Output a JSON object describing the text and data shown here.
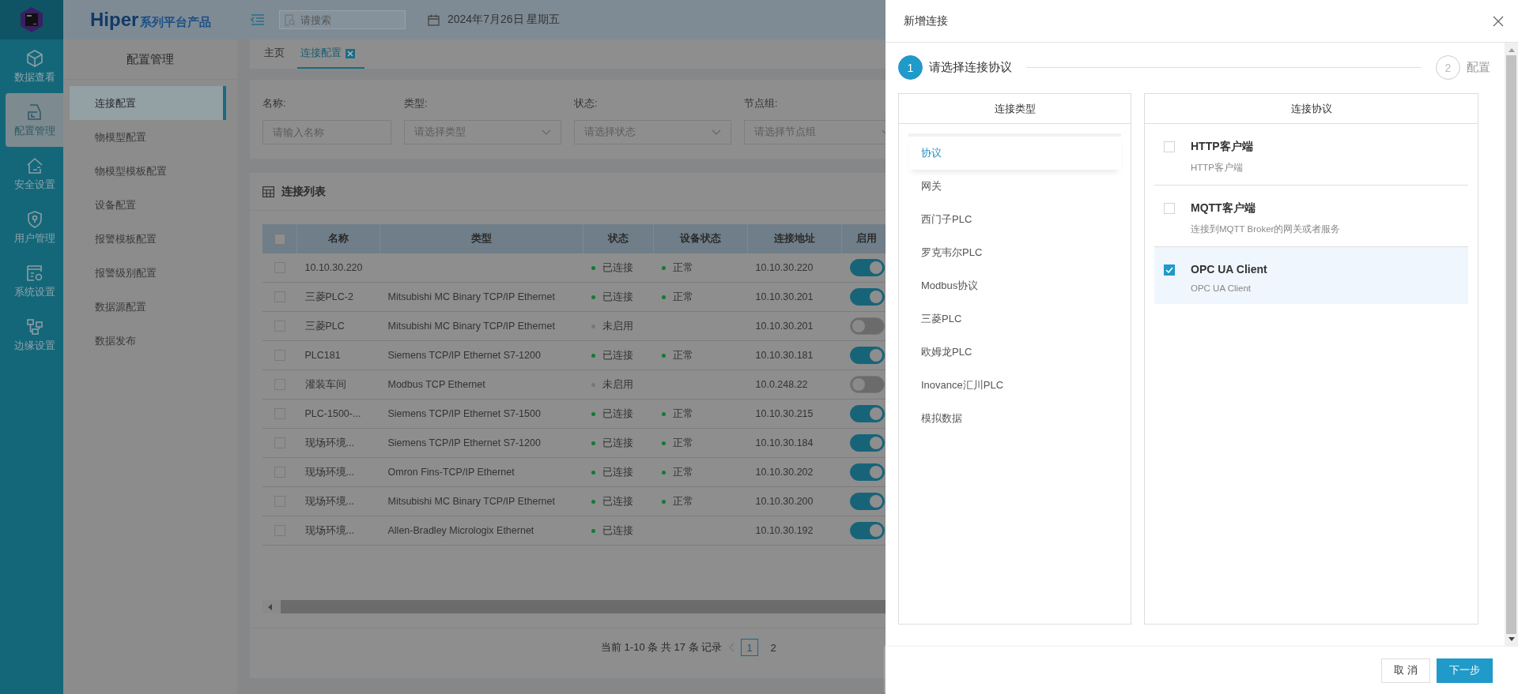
{
  "rail": {
    "items": [
      {
        "label": "数据查看",
        "selected": false
      },
      {
        "label": "配置管理",
        "selected": true
      },
      {
        "label": "安全设置",
        "selected": false
      },
      {
        "label": "用户管理",
        "selected": false
      },
      {
        "label": "系统设置",
        "selected": false
      },
      {
        "label": "边缘设置",
        "selected": false
      }
    ]
  },
  "sidebar": {
    "title": "配置管理",
    "items": [
      {
        "label": "连接配置",
        "selected": true
      },
      {
        "label": "物模型配置",
        "selected": false
      },
      {
        "label": "物模型模板配置",
        "selected": false
      },
      {
        "label": "设备配置",
        "selected": false
      },
      {
        "label": "报警模板配置",
        "selected": false
      },
      {
        "label": "报警级别配置",
        "selected": false
      },
      {
        "label": "数据源配置",
        "selected": false
      },
      {
        "label": "数据发布",
        "selected": false
      }
    ]
  },
  "topbar": {
    "logo": "Hiper",
    "logo_suffix": "系列平台产品",
    "search": {
      "placeholder": "请搜索"
    },
    "date": "2024年7月26日 星期五"
  },
  "tabs": [
    {
      "label": "主页",
      "selected": false,
      "closable": false
    },
    {
      "label": "连接配置",
      "selected": true,
      "closable": true
    }
  ],
  "filters": [
    {
      "label": "名称:",
      "placeholder": "请输入名称",
      "kind": "input"
    },
    {
      "label": "类型:",
      "placeholder": "请选择类型",
      "kind": "select"
    },
    {
      "label": "状态:",
      "placeholder": "请选择状态",
      "kind": "select"
    },
    {
      "label": "节点组:",
      "placeholder": "请选择节点组",
      "kind": "select"
    }
  ],
  "table": {
    "title": "连接列表",
    "all_checked": false,
    "columns": [
      "名称",
      "类型",
      "状态",
      "设备状态",
      "连接地址",
      "启用"
    ],
    "rows": [
      {
        "name": "10.10.30.220",
        "status": {
          "text": "已连接",
          "color": "#137a33"
        },
        "device_status": {
          "text": "正常",
          "color": "#137a33"
        },
        "address": "10.10.30.220",
        "enabled": true,
        "checked": false
      },
      {
        "name": "三菱PLC-2",
        "type": "Mitsubishi MC Binary TCP/IP Ethernet",
        "status": {
          "text": "已连接",
          "color": "#137a33"
        },
        "device_status": {
          "text": "正常",
          "color": "#137a33"
        },
        "address": "10.10.30.201",
        "enabled": true,
        "checked": false
      },
      {
        "name": "三菱PLC",
        "type": "Mitsubishi MC Binary TCP/IP Ethernet",
        "status": {
          "text": "未启用",
          "color": "#777777"
        },
        "address": "10.10.30.201",
        "enabled": false,
        "checked": false
      },
      {
        "name": "PLC181",
        "type": "Siemens TCP/IP Ethernet S7-1200",
        "status": {
          "text": "已连接",
          "color": "#137a33"
        },
        "device_status": {
          "text": "正常",
          "color": "#137a33"
        },
        "address": "10.10.30.181",
        "enabled": true,
        "checked": false
      },
      {
        "name": "灌装车间",
        "type": "Modbus TCP Ethernet",
        "status": {
          "text": "未启用",
          "color": "#777777"
        },
        "address": "10.0.248.22",
        "enabled": false,
        "checked": false
      },
      {
        "name": "PLC-1500-...",
        "type": "Siemens TCP/IP Ethernet S7-1500",
        "status": {
          "text": "已连接",
          "color": "#137a33"
        },
        "device_status": {
          "text": "正常",
          "color": "#137a33"
        },
        "address": "10.10.30.215",
        "enabled": true,
        "checked": false
      },
      {
        "name": "现场环境...",
        "type": "Siemens TCP/IP Ethernet S7-1200",
        "status": {
          "text": "已连接",
          "color": "#137a33"
        },
        "device_status": {
          "text": "正常",
          "color": "#137a33"
        },
        "address": "10.10.30.184",
        "enabled": true,
        "checked": false
      },
      {
        "name": "现场环境...",
        "type": "Omron Fins-TCP/IP Ethernet",
        "status": {
          "text": "已连接",
          "color": "#137a33"
        },
        "device_status": {
          "text": "正常",
          "color": "#137a33"
        },
        "address": "10.10.30.202",
        "enabled": true,
        "checked": false
      },
      {
        "name": "现场环境...",
        "type": "Mitsubishi MC Binary TCP/IP Ethernet",
        "status": {
          "text": "已连接",
          "color": "#137a33"
        },
        "device_status": {
          "text": "正常",
          "color": "#137a33"
        },
        "address": "10.10.30.200",
        "enabled": true,
        "checked": false
      },
      {
        "name": "现场环境...",
        "type": "Allen-Bradley Micrologix Ethernet",
        "status": {
          "text": "已连接",
          "color": "#137a33"
        },
        "address": "10.10.30.192",
        "enabled": true,
        "checked": false
      }
    ]
  },
  "pagination": {
    "summary": "当前 1-10 条 共 17 条 记录",
    "pages": [
      {
        "label": "1",
        "selected": true
      },
      {
        "label": "2",
        "selected": false
      }
    ]
  },
  "dialog": {
    "title": "新增连接",
    "steps": [
      {
        "number": "1",
        "label": "请选择连接协议",
        "selected": true
      },
      {
        "number": "2",
        "label": "配置",
        "selected": false
      }
    ],
    "type_panel": {
      "title": "连接类型",
      "items": [
        {
          "label": "协议",
          "selected": true
        },
        {
          "label": "网关",
          "selected": false
        },
        {
          "label": "西门子PLC",
          "selected": false
        },
        {
          "label": "罗克韦尔PLC",
          "selected": false
        },
        {
          "label": "Modbus协议",
          "selected": false
        },
        {
          "label": "三菱PLC",
          "selected": false
        },
        {
          "label": "欧姆龙PLC",
          "selected": false
        },
        {
          "label": "Inovance汇川PLC",
          "selected": false
        },
        {
          "label": "模拟数据",
          "selected": false
        }
      ]
    },
    "protocol_panel": {
      "title": "连接协议",
      "items": [
        {
          "name": "HTTP客户端",
          "description": "HTTP客户端",
          "checked": false,
          "selected": false
        },
        {
          "name": "MQTT客户端",
          "description": "连接到MQTT Broker的网关或者服务",
          "checked": false,
          "selected": false
        },
        {
          "name": "OPC UA Client",
          "description": "OPC UA Client",
          "checked": true,
          "selected": true
        }
      ]
    },
    "buttons": [
      {
        "label": "取 消",
        "kind": "secondary"
      },
      {
        "label": "下一步",
        "kind": "primary"
      }
    ]
  }
}
